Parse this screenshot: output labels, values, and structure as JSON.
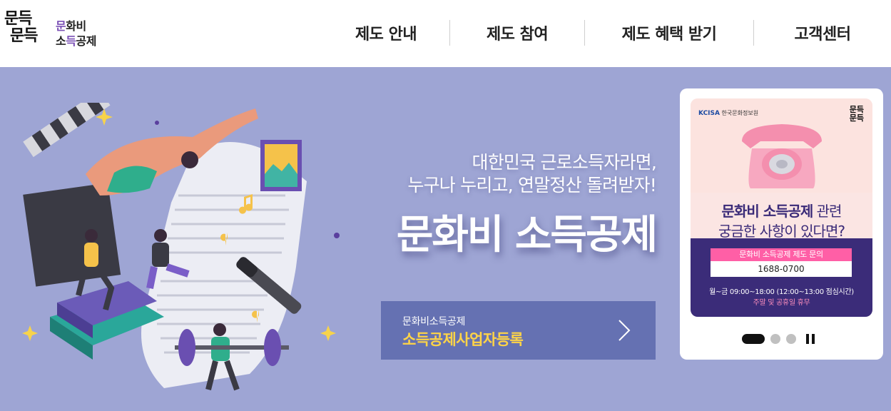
{
  "logo": {
    "hand_line1": "문득",
    "hand_line2": "문득",
    "text_line1_a": "문",
    "text_line1_b": "화비",
    "text_line2_a": "소",
    "text_line2_b": "득",
    "text_line2_c": "공제"
  },
  "nav": {
    "items": [
      {
        "label": "제도 안내"
      },
      {
        "label": "제도 참여"
      },
      {
        "label": "제도 혜택 받기"
      },
      {
        "label": "고객센터"
      }
    ]
  },
  "hero": {
    "sub1": "대한민국 근로소득자라면,",
    "sub2": "누구나 누리고, 연말정산 돌려받자!",
    "title": "문화비 소득공제",
    "bg_color": "#9ea5d4"
  },
  "register_button": {
    "small": "문화비소득공제",
    "big": "소득공제사업자등록"
  },
  "banner": {
    "org_mark": "KCISA",
    "org_name": "한국문화정보원",
    "mini_logo_1": "문득",
    "mini_logo_2": "문득",
    "title_bold": "문화비 소득공제",
    "title_rest": " 관련",
    "title2": "궁금한 사항이 있다면?",
    "pill": "문화비 소득공제 제도 문의",
    "phone": "1688-0700",
    "hours": "월~금 09:00~18:00 (12:00~13:00 점심시간)",
    "closed": "주말 및 공휴일 휴무"
  },
  "slider": {
    "total": 3,
    "active": 1
  },
  "icons": [
    "chevron-right-icon",
    "pause-icon",
    "telephone-icon"
  ]
}
